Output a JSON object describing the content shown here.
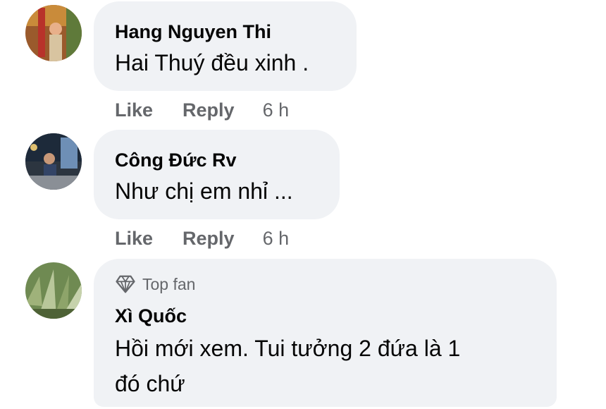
{
  "comments": [
    {
      "author": "Hang Nguyen Thi",
      "text": "Hai Thuý đều xinh .",
      "like_label": "Like",
      "reply_label": "Reply",
      "time": "6 h"
    },
    {
      "author": "Công Đức Rv",
      "text": "Như chị em nhỉ ...",
      "like_label": "Like",
      "reply_label": "Reply",
      "time": "6 h"
    },
    {
      "badge": "Top fan",
      "badge_icon": "diamond-icon",
      "author": "Xì Quốc",
      "text_line1": "Hồi mới xem. Tui tưởng 2 đứa là 1",
      "text_line2": "đó chứ"
    }
  ],
  "colors": {
    "bubble": "#f0f2f5",
    "text": "#050505",
    "secondary": "#65676b"
  }
}
